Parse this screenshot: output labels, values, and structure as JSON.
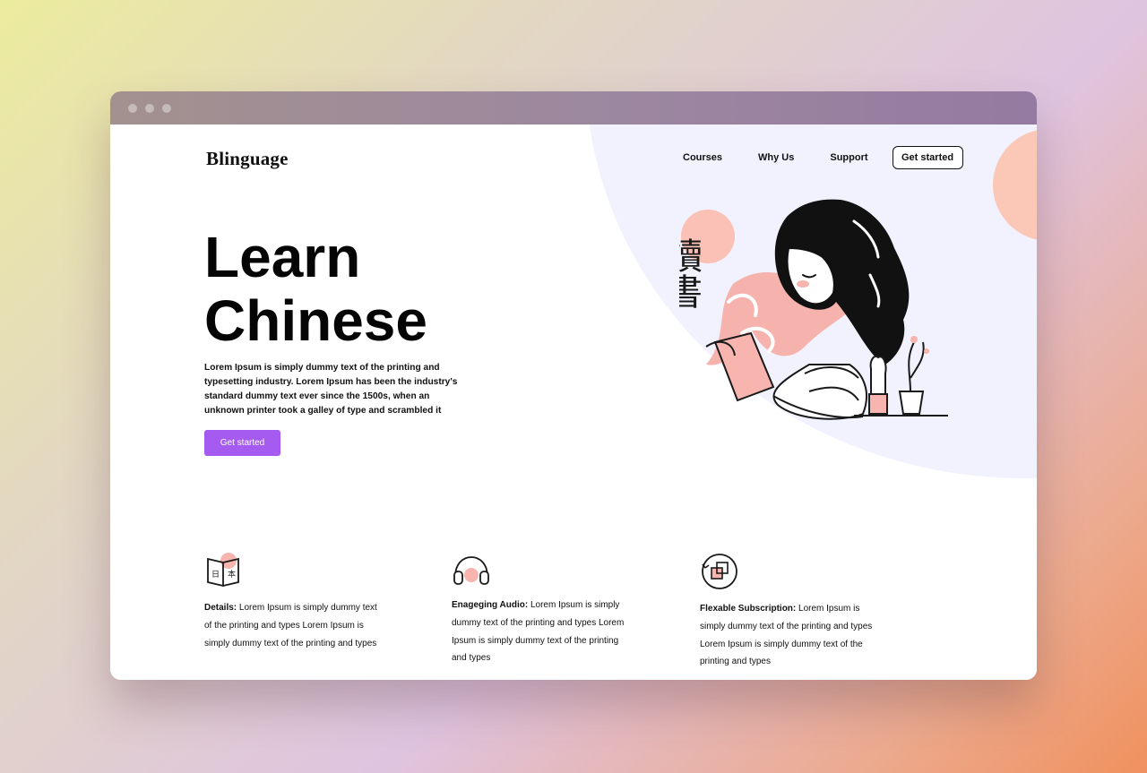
{
  "app": {
    "brand": "Blinguage"
  },
  "nav": {
    "items": [
      "Courses",
      "Why Us",
      "Support"
    ],
    "cta": "Get started"
  },
  "hero": {
    "title_line1": "Learn",
    "title_line2": "Chinese",
    "description": "Lorem Ipsum is simply dummy text of the printing and typesetting industry. Lorem Ipsum has been the industry's standard dummy text ever since the 1500s, when an unknown printer took a galley of type and scrambled it",
    "button": "Get started",
    "illustration_text": "讀書"
  },
  "features": [
    {
      "icon": "book-icon",
      "title": "Details:",
      "text": " Lorem Ipsum is simply dummy text of the printing and types Lorem Ipsum is simply dummy text of the printing and types"
    },
    {
      "icon": "headphones-icon",
      "title": "Enageging Audio:",
      "text": " Lorem Ipsum is simply dummy text of the printing and types Lorem Ipsum is simply dummy text of the printing and types"
    },
    {
      "icon": "subscription-icon",
      "title": "Flexable Subscription:",
      "text": " Lorem Ipsum is simply dummy text of the printing and types Lorem Ipsum is simply dummy text of the printing and types"
    }
  ],
  "colors": {
    "accent": "#a55af0",
    "peach": "#fbc7b7",
    "blob": "#f1f2fd",
    "titlebar": "#9c87a0"
  }
}
